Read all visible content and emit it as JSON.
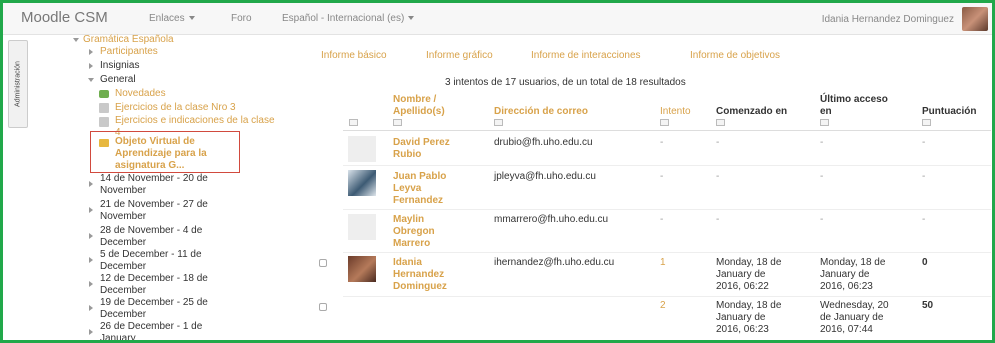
{
  "navbar": {
    "brand": "Moodle CSM",
    "links": [
      "Enlaces",
      "Foro",
      "Español - Internacional (es)"
    ],
    "user_name": "Idania Hernandez Dominguez"
  },
  "admin_tab": "Administración",
  "tree": {
    "course": "Gramática Española",
    "participants": "Participantes",
    "badges": "Insignias",
    "general": "General",
    "items": [
      "Novedades",
      "Ejercicios de la clase Nro 3",
      "Ejercicios e indicaciones de la clase 4"
    ],
    "selected": [
      "Objeto Virtual de",
      "Aprendizaje para la",
      "asignatura G..."
    ],
    "weeks": [
      [
        "14 de November - 20 de",
        "November"
      ],
      [
        "21 de November - 27 de",
        "November"
      ],
      [
        "28 de November - 4 de",
        "December"
      ],
      [
        "5 de December - 11 de",
        "December"
      ],
      [
        "12 de December - 18 de",
        "December"
      ],
      [
        "19 de December - 25 de",
        "December"
      ],
      [
        "26 de December - 1 de",
        "January"
      ]
    ]
  },
  "report_tabs": [
    "Informe básico",
    "Informe gráfico",
    "Informe de interacciones",
    "Informe de objetivos"
  ],
  "summary": "3 intentos de 17 usuarios, de un total de 18 resultados",
  "table": {
    "headers": {
      "name": [
        "Nombre /",
        "Apellido(s)"
      ],
      "email": "Dirección de correo",
      "attempt": "Intento",
      "started": "Comenzado en",
      "last": [
        "Último acceso",
        "en"
      ],
      "score": "Puntuación"
    },
    "rows": [
      {
        "name": [
          "David Perez",
          "Rubio"
        ],
        "email": "drubio@fh.uho.edu.cu",
        "attempt": "-",
        "started": [
          "-"
        ],
        "last": [
          "-"
        ],
        "score": "-"
      },
      {
        "name": [
          "Juan Pablo",
          "Leyva",
          "Fernandez"
        ],
        "email": "jpleyva@fh.uho.edu.cu",
        "attempt": "-",
        "started": [
          "-"
        ],
        "last": [
          "-"
        ],
        "score": "-"
      },
      {
        "name": [
          "Maylin",
          "Obregon",
          "Marrero"
        ],
        "email": "mmarrero@fh.uho.edu.cu",
        "attempt": "-",
        "started": [
          "-"
        ],
        "last": [
          "-"
        ],
        "score": "-"
      },
      {
        "name": [
          "Idania",
          "Hernandez",
          "Dominguez"
        ],
        "email": "ihernandez@fh.uho.edu.cu",
        "attempt": "1",
        "started": [
          "Monday, 18 de",
          "January de",
          "2016, 06:22"
        ],
        "last": [
          "Monday, 18 de",
          "January de",
          "2016, 06:23"
        ],
        "score": "0"
      },
      {
        "name": [],
        "email": "",
        "attempt": "2",
        "started": [
          "Monday, 18 de",
          "January de",
          "2016, 06:23"
        ],
        "last": [
          "Wednesday, 20",
          "de January de",
          "2016, 07:44"
        ],
        "score": "50"
      }
    ]
  }
}
